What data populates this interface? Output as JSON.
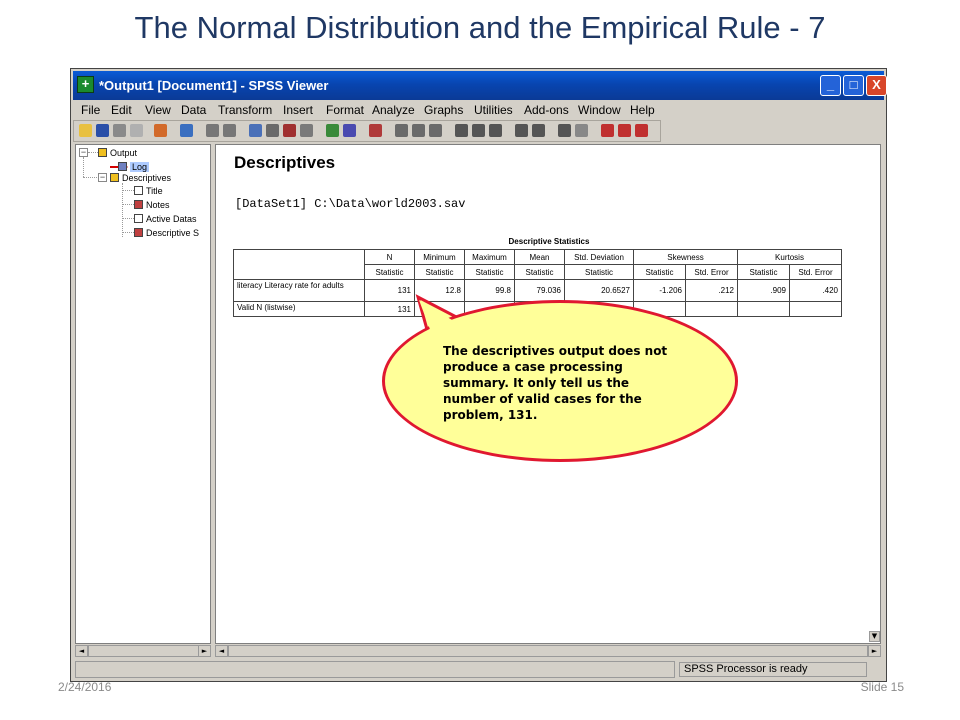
{
  "slide": {
    "title": "The Normal Distribution and the Empirical Rule - 7",
    "date": "2/24/2016",
    "slide_number": "Slide 15"
  },
  "window": {
    "title": "*Output1 [Document1] - SPSS Viewer",
    "controls": {
      "minimize": "_",
      "maximize": "□",
      "close": "X"
    }
  },
  "menu": [
    "File",
    "Edit",
    "View",
    "Data",
    "Transform",
    "Insert",
    "Format",
    "Analyze",
    "Graphs",
    "Utilities",
    "Add-ons",
    "Window",
    "Help"
  ],
  "tree": {
    "output": "Output",
    "log": "Log",
    "descriptives": "Descriptives",
    "title": "Title",
    "notes": "Notes",
    "active_dataset": "Active Datas",
    "descriptive_statistics": "Descriptive S",
    "expander_collapse": "−"
  },
  "content": {
    "heading": "Descriptives",
    "dataset_line": "[DataSet1] C:\\Data\\world2003.sav",
    "table": {
      "title": "Descriptive Statistics",
      "header": {
        "n": "N",
        "minimum": "Minimum",
        "maximum": "Maximum",
        "mean": "Mean",
        "std_deviation": "Std. Deviation",
        "skewness": "Skewness",
        "kurtosis": "Kurtosis"
      },
      "subheader": [
        "Statistic",
        "Statistic",
        "Statistic",
        "Statistic",
        "Statistic",
        "Statistic",
        "Std. Error",
        "Statistic",
        "Std. Error"
      ],
      "rows": [
        {
          "label": "literacy Literacy rate for adults",
          "n": "131",
          "minimum": "12.8",
          "maximum": "99.8",
          "mean": "79.036",
          "std_deviation": "20.6527",
          "skewness_stat": "-1.206",
          "skewness_se": ".212",
          "kurtosis_stat": ".909",
          "kurtosis_se": ".420"
        },
        {
          "label": "Valid N (listwise)",
          "n": "131"
        }
      ]
    }
  },
  "callout": {
    "text": "The descriptives output does not produce a case processing summary. It only tell us the number of valid cases for the problem, 131."
  },
  "status": {
    "text": "SPSS  Processor is ready"
  },
  "scroll": {
    "left": "◄",
    "right": "►",
    "up": "▲",
    "down": "▼"
  },
  "colors": {
    "title_blue": "#1f3864",
    "callout_fill": "#ffff99",
    "callout_border": "#e01830",
    "titlebar": "#0845b0"
  }
}
